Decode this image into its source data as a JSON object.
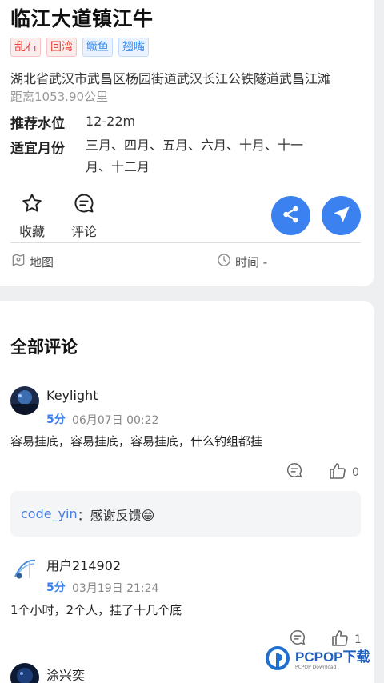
{
  "spot": {
    "title": "临江大道镇江牛",
    "tags": [
      {
        "label": "乱石",
        "style": "red"
      },
      {
        "label": "回湾",
        "style": "red"
      },
      {
        "label": "鳜鱼",
        "style": "blue"
      },
      {
        "label": "翘嘴",
        "style": "blue"
      }
    ],
    "address": "湖北省武汉市武昌区杨园街道武汉长江公铁隧道武昌江滩",
    "distance": "距离1053.90公里",
    "depth_label": "推荐水位",
    "depth_value": "12-22m",
    "months_label": "适宜月份",
    "months_line1": "三月、四月、五月、六月、十月、十一",
    "months_line2": "月、十二月"
  },
  "actions": {
    "favorite_label": "收藏",
    "comment_label": "评论",
    "map_label": "地图",
    "time_label": "时间 -"
  },
  "comments_section": {
    "title": "全部评论",
    "items": [
      {
        "user": "Keylight",
        "score": "5分",
        "date": "06月07日 00:22",
        "text": "容易挂底，容易挂底，容易挂底，什么钓组都挂",
        "likes": "0"
      },
      {
        "user": "用户214902",
        "score": "5分",
        "date": "03月19日 21:24",
        "text": "1个小时，2个人，挂了十几个底",
        "likes": "1"
      },
      {
        "user": "涂兴奕"
      }
    ],
    "reply": {
      "user": "code_yin",
      "sep": "：",
      "text": "感谢反馈😁"
    }
  },
  "watermark": {
    "brand": "PCPOP下载",
    "sub": "PCPOP Download"
  },
  "colors": {
    "accent": "#3b82f0",
    "tag_red": "#e8413c",
    "tag_blue": "#3a8bf0"
  }
}
